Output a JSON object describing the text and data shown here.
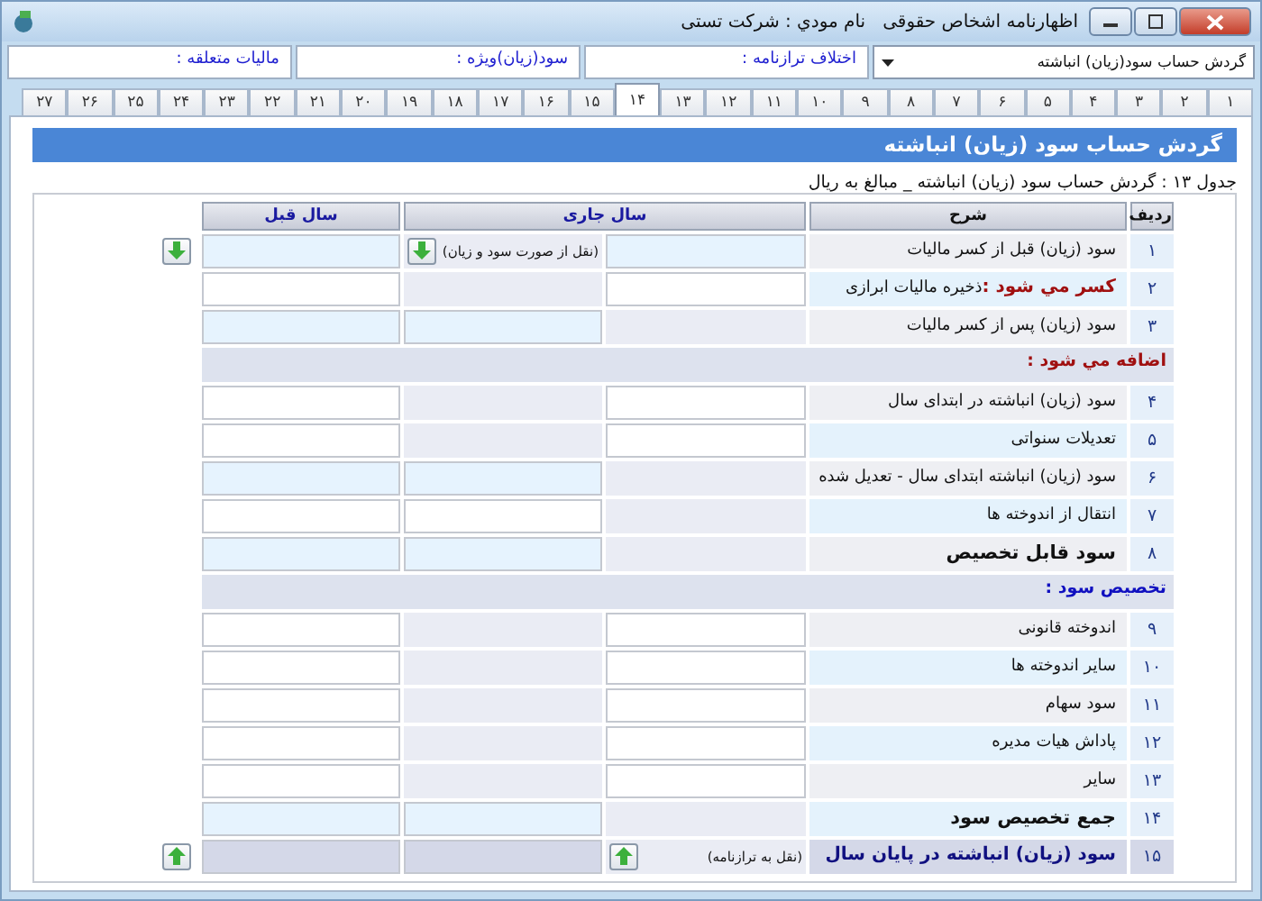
{
  "window": {
    "title": "اظهارنامه اشخاص حقوقی   نام مودي : شرکت تستی"
  },
  "header": {
    "form_select": {
      "value": "گردش حساب سود(زیان) انباشته"
    },
    "fields": [
      {
        "label": "اختلاف ترازنامه :"
      },
      {
        "label": "سود(زیان)ویژه :"
      },
      {
        "label": "مالیات متعلقه :"
      }
    ]
  },
  "tabs": [
    {
      "label": "۱",
      "selected": false
    },
    {
      "label": "۲",
      "selected": false
    },
    {
      "label": "۳",
      "selected": false
    },
    {
      "label": "۴",
      "selected": false
    },
    {
      "label": "۵",
      "selected": false
    },
    {
      "label": "۶",
      "selected": false
    },
    {
      "label": "۷",
      "selected": false
    },
    {
      "label": "۸",
      "selected": false
    },
    {
      "label": "۹",
      "selected": false
    },
    {
      "label": "۱۰",
      "selected": false
    },
    {
      "label": "۱۱",
      "selected": false
    },
    {
      "label": "۱۲",
      "selected": false
    },
    {
      "label": "۱۳",
      "selected": false
    },
    {
      "label": "۱۴",
      "selected": true
    },
    {
      "label": "۱۵",
      "selected": false
    },
    {
      "label": "۱۶",
      "selected": false
    },
    {
      "label": "۱۷",
      "selected": false
    },
    {
      "label": "۱۸",
      "selected": false
    },
    {
      "label": "۱۹",
      "selected": false
    },
    {
      "label": "۲۰",
      "selected": false
    },
    {
      "label": "۲۱",
      "selected": false
    },
    {
      "label": "۲۲",
      "selected": false
    },
    {
      "label": "۲۳",
      "selected": false
    },
    {
      "label": "۲۴",
      "selected": false
    },
    {
      "label": "۲۵",
      "selected": false
    },
    {
      "label": "۲۶",
      "selected": false
    },
    {
      "label": "۲۷",
      "selected": false
    }
  ],
  "page": {
    "heading": "گردش حساب سود (زیان) انباشته",
    "caption": "جدول ۱۳ : گردش حساب سود (زیان) انباشته _ مبالغ به ریال",
    "columns": {
      "row_no": "ردیف",
      "description": "شرح",
      "current_year": "سال جاری",
      "prior_year": "سال قبل"
    },
    "rows": [
      {
        "kind": "row",
        "no": "۱",
        "label": "سود (زیان) قبل از کسر مالیات",
        "cells": [
          {
            "kind": "calc"
          },
          {
            "kind": "blank",
            "note": "(نقل از صورت سود و زیان)",
            "button": {
              "kind": "down"
            }
          },
          {
            "kind": "calc"
          }
        ],
        "side_button": {
          "kind": "down"
        }
      },
      {
        "kind": "row",
        "no": "۲",
        "prefix": "کسر مي شود :",
        "label": "ذخیره مالیات ابرازی",
        "cells": [
          {
            "kind": "input"
          },
          {
            "kind": "blank"
          },
          {
            "kind": "input"
          }
        ]
      },
      {
        "kind": "row",
        "no": "۳",
        "label": "سود (زیان) پس از کسر مالیات",
        "cells": [
          {
            "kind": "blank"
          },
          {
            "kind": "calc"
          },
          {
            "kind": "calc"
          }
        ]
      },
      {
        "kind": "section",
        "label": "اضافه مي شود :",
        "color": "#a01010"
      },
      {
        "kind": "row",
        "no": "۴",
        "label": "سود (زیان) انباشته در ابتدای سال",
        "cells": [
          {
            "kind": "input"
          },
          {
            "kind": "blank"
          },
          {
            "kind": "input"
          }
        ]
      },
      {
        "kind": "row",
        "no": "۵",
        "label": "تعدیلات سنواتی",
        "cells": [
          {
            "kind": "input"
          },
          {
            "kind": "blank"
          },
          {
            "kind": "input"
          }
        ]
      },
      {
        "kind": "row",
        "no": "۶",
        "label": "سود (زیان) انباشته ابتدای سال - تعدیل شده",
        "cells": [
          {
            "kind": "blank"
          },
          {
            "kind": "calc"
          },
          {
            "kind": "calc"
          }
        ]
      },
      {
        "kind": "row",
        "no": "۷",
        "label": "انتقال از اندوخته ها",
        "cells": [
          {
            "kind": "blank"
          },
          {
            "kind": "input"
          },
          {
            "kind": "input"
          }
        ]
      },
      {
        "kind": "row",
        "no": "۸",
        "label": "سود قابل تخصیص",
        "bold": true,
        "cells": [
          {
            "kind": "blank"
          },
          {
            "kind": "calc"
          },
          {
            "kind": "calc"
          }
        ]
      },
      {
        "kind": "section",
        "label": "تخصیص سود :",
        "color": "#1010c0"
      },
      {
        "kind": "row",
        "no": "۹",
        "label": "اندوخته قانونی",
        "cells": [
          {
            "kind": "input"
          },
          {
            "kind": "blank"
          },
          {
            "kind": "input"
          }
        ]
      },
      {
        "kind": "row",
        "no": "۱۰",
        "label": "سایر اندوخته ها",
        "cells": [
          {
            "kind": "input"
          },
          {
            "kind": "blank"
          },
          {
            "kind": "input"
          }
        ]
      },
      {
        "kind": "row",
        "no": "۱۱",
        "label": "سود سهام",
        "cells": [
          {
            "kind": "input"
          },
          {
            "kind": "blank"
          },
          {
            "kind": "input"
          }
        ]
      },
      {
        "kind": "row",
        "no": "۱۲",
        "label": "پاداش هیات مدیره",
        "cells": [
          {
            "kind": "input"
          },
          {
            "kind": "blank"
          },
          {
            "kind": "input"
          }
        ]
      },
      {
        "kind": "row",
        "no": "۱۳",
        "label": "سایر",
        "cells": [
          {
            "kind": "input"
          },
          {
            "kind": "blank"
          },
          {
            "kind": "input"
          }
        ]
      },
      {
        "kind": "row",
        "no": "۱۴",
        "label": "جمع تخصیص سود",
        "bold": true,
        "cells": [
          {
            "kind": "blank"
          },
          {
            "kind": "calc"
          },
          {
            "kind": "calc"
          }
        ]
      },
      {
        "kind": "total",
        "no": "۱۵",
        "label": "سود (زیان) انباشته در پایان سال",
        "bold": true,
        "cells": [
          {
            "kind": "blank",
            "note": "(نقل به ترازنامه)",
            "button": {
              "kind": "up"
            }
          },
          {
            "kind": "total"
          },
          {
            "kind": "total"
          }
        ],
        "side_button": {
          "kind": "up"
        }
      }
    ]
  }
}
